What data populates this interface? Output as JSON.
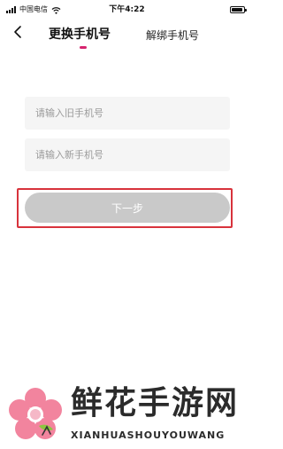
{
  "status_bar": {
    "carrier": "中国电信",
    "time": "下午4:22",
    "battery_level": 0.95
  },
  "nav": {
    "back_icon": "chevron-left-icon",
    "tabs": [
      {
        "label": "更换手机号",
        "active": true
      },
      {
        "label": "解绑手机号",
        "active": false
      }
    ]
  },
  "form": {
    "old_phone_placeholder": "请输入旧手机号",
    "new_phone_placeholder": "请输入新手机号",
    "next_label": "下一步"
  },
  "colors": {
    "accent": "#d6246e",
    "button_disabled": "#c9c9c9",
    "highlight_border": "#d8333c",
    "field_bg": "#f5f5f5"
  },
  "watermark": {
    "name": "鲜花手游网",
    "sub": "XIANHUASHOUYOUWANG"
  }
}
